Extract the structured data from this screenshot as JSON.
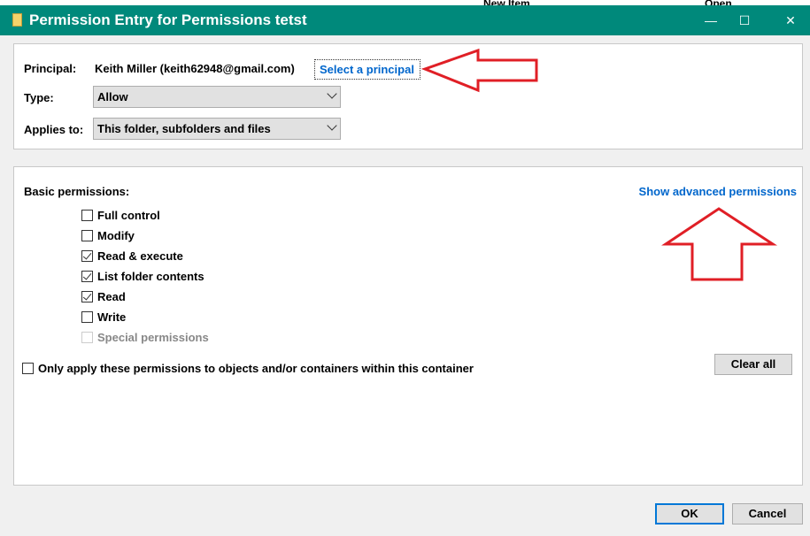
{
  "background_app": {
    "tools": [
      "New Item",
      "Open"
    ]
  },
  "titlebar": {
    "title": "Permission Entry for Permissions tetst",
    "minimize": "—",
    "maximize": "☐",
    "close": "✕"
  },
  "principal": {
    "label": "Principal:",
    "value": "Keith Miller (keith62948@gmail.com)",
    "select_link": "Select a principal"
  },
  "type": {
    "label": "Type:",
    "value": "Allow"
  },
  "applies_to": {
    "label": "Applies to:",
    "value": "This folder, subfolders and files"
  },
  "basic_permissions": {
    "label": "Basic permissions:",
    "advanced_link": "Show advanced permissions",
    "items": [
      {
        "label": "Full control",
        "checked": false,
        "disabled": false
      },
      {
        "label": "Modify",
        "checked": false,
        "disabled": false
      },
      {
        "label": "Read & execute",
        "checked": true,
        "disabled": false
      },
      {
        "label": "List folder contents",
        "checked": true,
        "disabled": false
      },
      {
        "label": "Read",
        "checked": true,
        "disabled": false
      },
      {
        "label": "Write",
        "checked": false,
        "disabled": false
      },
      {
        "label": "Special permissions",
        "checked": false,
        "disabled": true
      }
    ]
  },
  "only_apply": {
    "label": "Only apply these permissions to objects and/or containers within this container",
    "checked": false
  },
  "buttons": {
    "clear_all": "Clear all",
    "ok": "OK",
    "cancel": "Cancel"
  },
  "annotation_color": "#e01f26"
}
